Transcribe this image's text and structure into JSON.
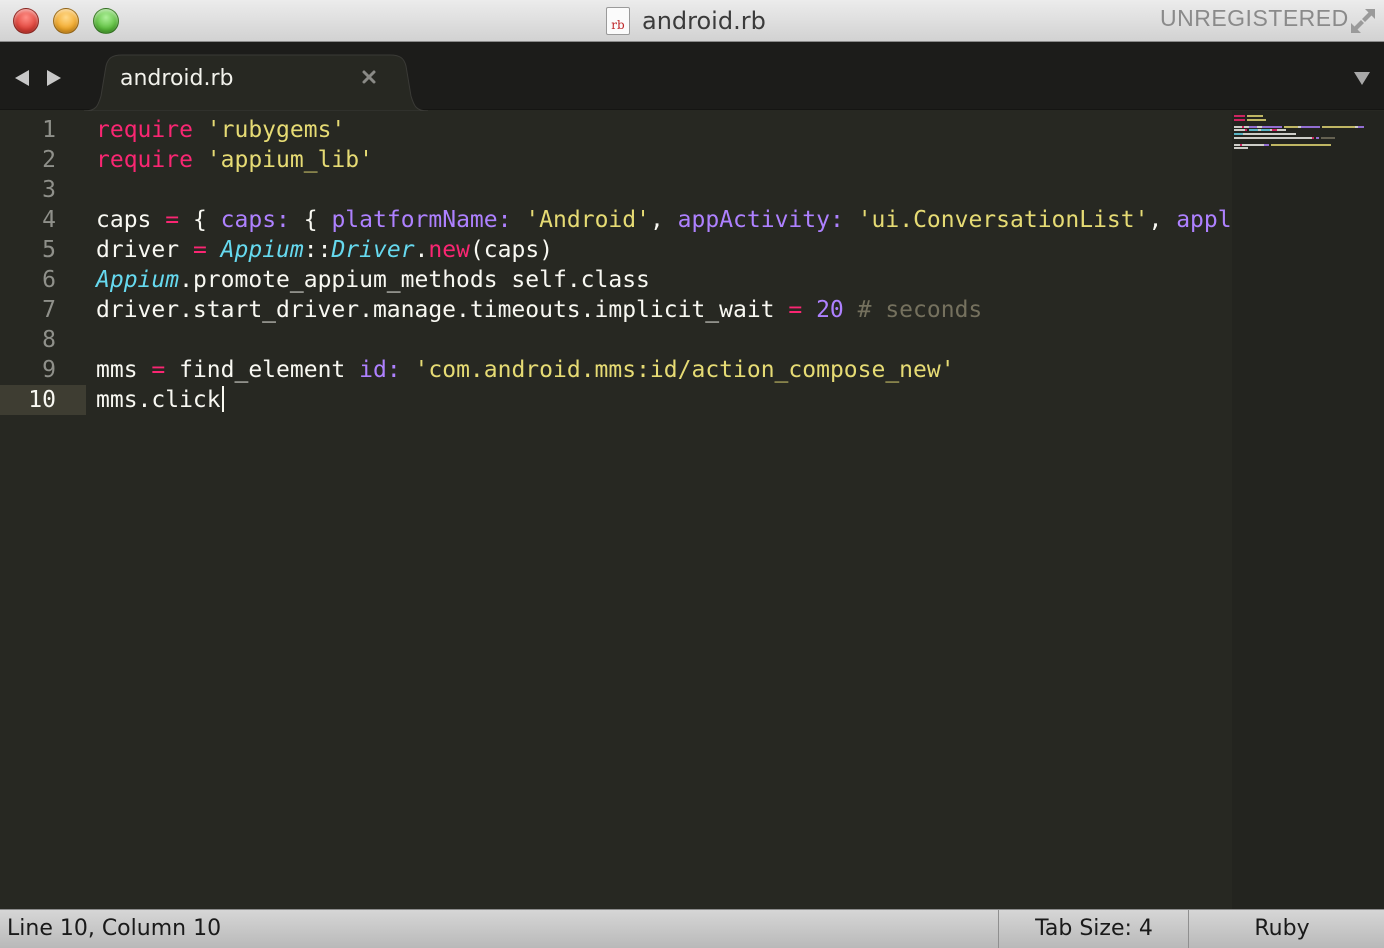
{
  "window": {
    "title": "android.rb",
    "file_icon_label": "rb",
    "license_label": "UNREGISTERED"
  },
  "tabs": [
    {
      "label": "android.rb",
      "active": true
    }
  ],
  "editor": {
    "line_numbers": [
      "1",
      "2",
      "3",
      "4",
      "5",
      "6",
      "7",
      "8",
      "9",
      "10"
    ],
    "active_line": 10,
    "lines": [
      [
        {
          "t": "require",
          "c": "kw"
        },
        {
          "t": " "
        },
        {
          "t": "'rubygems'",
          "c": "str"
        }
      ],
      [
        {
          "t": "require",
          "c": "kw"
        },
        {
          "t": " "
        },
        {
          "t": "'appium_lib'",
          "c": "str"
        }
      ],
      [],
      [
        {
          "t": "caps "
        },
        {
          "t": "=",
          "c": "kw"
        },
        {
          "t": " { "
        },
        {
          "t": "caps:",
          "c": "sym"
        },
        {
          "t": " { "
        },
        {
          "t": "platformName:",
          "c": "sym"
        },
        {
          "t": " "
        },
        {
          "t": "'Android'",
          "c": "str"
        },
        {
          "t": ", "
        },
        {
          "t": "appActivity:",
          "c": "sym"
        },
        {
          "t": " "
        },
        {
          "t": "'ui.ConversationList'",
          "c": "str"
        },
        {
          "t": ", "
        },
        {
          "t": "appl",
          "c": "sym"
        }
      ],
      [
        {
          "t": "driver "
        },
        {
          "t": "=",
          "c": "kw"
        },
        {
          "t": " "
        },
        {
          "t": "Appium",
          "c": "cls"
        },
        {
          "t": "::"
        },
        {
          "t": "Driver",
          "c": "cls"
        },
        {
          "t": "."
        },
        {
          "t": "new",
          "c": "kw"
        },
        {
          "t": "(caps)"
        }
      ],
      [
        {
          "t": "Appium",
          "c": "cls"
        },
        {
          "t": ".promote_appium_methods self.class"
        }
      ],
      [
        {
          "t": "driver.start_driver.manage.timeouts.implicit_wait "
        },
        {
          "t": "=",
          "c": "kw"
        },
        {
          "t": " "
        },
        {
          "t": "20",
          "c": "num"
        },
        {
          "t": " "
        },
        {
          "t": "# seconds",
          "c": "cmt"
        }
      ],
      [],
      [
        {
          "t": "mms "
        },
        {
          "t": "=",
          "c": "kw"
        },
        {
          "t": " find_element "
        },
        {
          "t": "id:",
          "c": "sym"
        },
        {
          "t": " "
        },
        {
          "t": "'com.android.mms:id/action_compose_new'",
          "c": "str"
        }
      ],
      [
        {
          "t": "mms.click"
        }
      ]
    ]
  },
  "statusbar": {
    "position": "Line 10, Column 10",
    "tab_size": "Tab Size: 4",
    "syntax": "Ruby"
  },
  "colors": {
    "background": "#272822",
    "keyword": "#f92672",
    "string": "#e6db74",
    "symbol": "#ae81ff",
    "class": "#66d9ef",
    "comment": "#75715e",
    "text": "#f8f8f2"
  },
  "icons": {
    "nav_back": "triangle-left-icon",
    "nav_forward": "triangle-right-icon",
    "tab_close": "close-icon",
    "tab_menu": "chevron-down-icon",
    "fullscreen": "fullscreen-arrows-icon"
  }
}
